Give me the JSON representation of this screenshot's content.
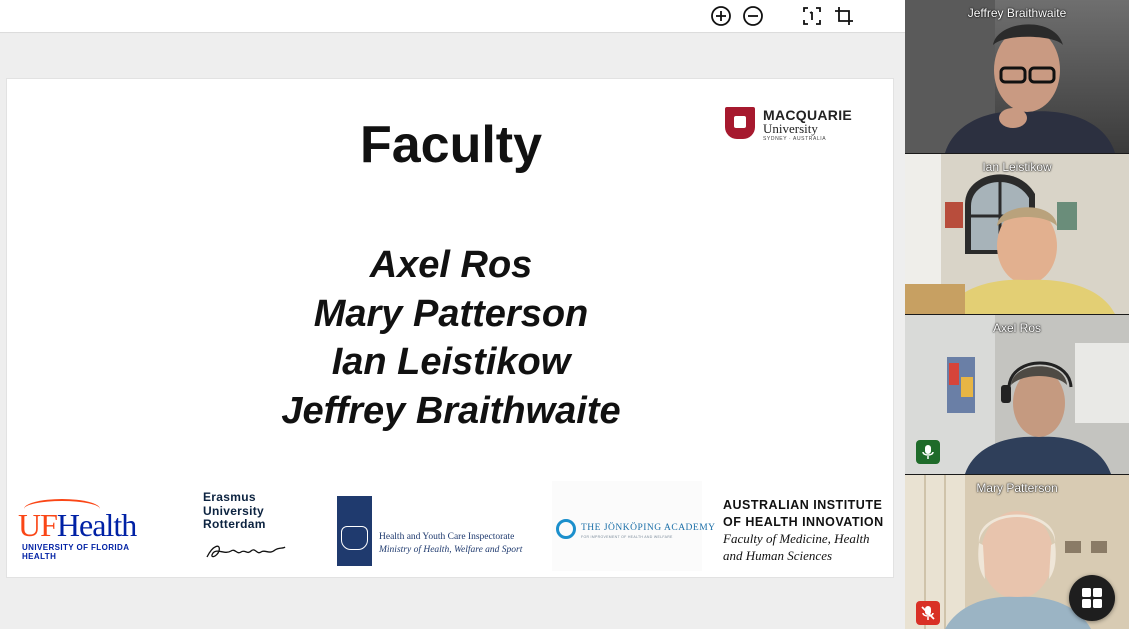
{
  "toolbar": {
    "zoom_in_icon": "plus-circle",
    "zoom_out_icon": "minus-circle",
    "fit_icon": "fit-to-page",
    "crop_icon": "crop"
  },
  "slide": {
    "title": "Faculty",
    "names": [
      "Axel Ros",
      "Mary Patterson",
      "Ian Leistikow",
      "Jeffrey Braithwaite"
    ],
    "logos": {
      "macquarie": {
        "line1": "MACQUARIE",
        "line2": "University",
        "line3": "SYDNEY · AUSTRALIA"
      },
      "ufhealth": {
        "u": "UF",
        "h": "Health",
        "sub": "UNIVERSITY OF FLORIDA HEALTH"
      },
      "erasmus": {
        "line1": "Erasmus",
        "line2": "University",
        "line3": "Rotterdam"
      },
      "inspectorate": {
        "line1": "Health and Youth Care Inspectorate",
        "line2": "Ministry of Health, Welfare and Sport"
      },
      "jonkoping": {
        "line1": "THE JÖNKÖPING ACADEMY",
        "line2": "FOR IMPROVEMENT OF HEALTH AND WELFARE"
      },
      "aihi": {
        "line1": "AUSTRALIAN INSTITUTE",
        "line2": "OF HEALTH INNOVATION",
        "line3": "Faculty of Medicine, Health",
        "line4": "and Human Sciences"
      }
    }
  },
  "participants": [
    {
      "name": "Jeffrey Braithwaite",
      "mic": "none"
    },
    {
      "name": "Ian Leistikow",
      "mic": "none"
    },
    {
      "name": "Axel Ros",
      "mic": "on"
    },
    {
      "name": "Mary Patterson",
      "mic": "muted"
    }
  ],
  "colors": {
    "mic_on": "#1f6b2a",
    "mic_muted": "#d93025",
    "macquarie_red": "#a6192e",
    "uf_orange": "#fa4616",
    "uf_blue": "#0021a5"
  },
  "controls": {
    "layout_icon": "grid-icon"
  }
}
